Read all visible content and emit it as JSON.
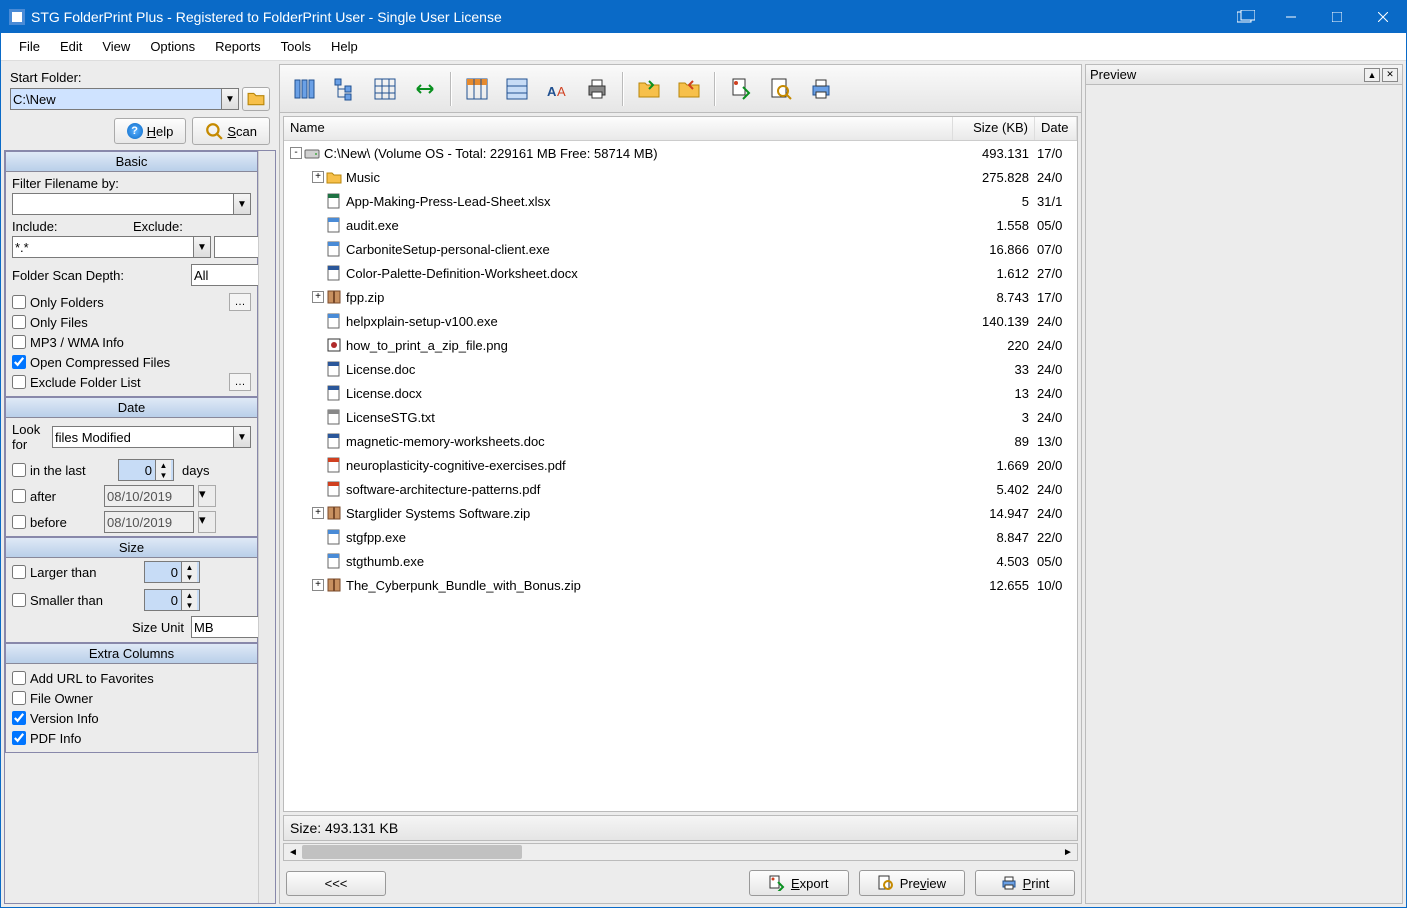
{
  "titlebar": "STG FolderPrint Plus - Registered to FolderPrint User - Single User License",
  "menu": [
    "File",
    "Edit",
    "View",
    "Options",
    "Reports",
    "Tools",
    "Help"
  ],
  "start": {
    "label": "Start Folder:",
    "value": "C:\\New",
    "help": "Help",
    "scan": "Scan"
  },
  "basic": {
    "title": "Basic",
    "filter_label": "Filter Filename by:",
    "filter_value": "",
    "include_label": "Include:",
    "include_value": "*.*",
    "exclude_label": "Exclude:",
    "exclude_value": "",
    "depth_label": "Folder Scan Depth:",
    "depth_value": "All",
    "only_folders": "Only Folders",
    "only_files": "Only Files",
    "mp3": "MP3 / WMA Info",
    "open_compressed": "Open Compressed Files",
    "exclude_list": "Exclude Folder List"
  },
  "date": {
    "title": "Date",
    "lookfor_label": "Look for",
    "lookfor_value": "files Modified",
    "inlast_label": "in the last",
    "inlast_value": "0",
    "days": "days",
    "after_label": "after",
    "after_value": "08/10/2019",
    "before_label": "before",
    "before_value": "08/10/2019"
  },
  "size": {
    "title": "Size",
    "larger": "Larger than",
    "larger_v": "0",
    "smaller": "Smaller than",
    "smaller_v": "0",
    "unit_label": "Size Unit",
    "unit_value": "MB"
  },
  "extra": {
    "title": "Extra Columns",
    "addurl": "Add URL to Favorites",
    "owner": "File Owner",
    "version": "Version Info",
    "pdf": "PDF Info"
  },
  "columns": {
    "name": "Name",
    "size": "Size (KB)",
    "date": "Date"
  },
  "rows": [
    {
      "depth": 0,
      "exp": "-",
      "icon": "drive",
      "name": "C:\\New\\ (Volume OS - Total: 229161 MB Free: 58714 MB)",
      "size": "493.131",
      "date": "17/0"
    },
    {
      "depth": 1,
      "exp": "+",
      "icon": "folder",
      "name": "Music",
      "size": "275.828",
      "date": "24/0"
    },
    {
      "depth": 1,
      "exp": "",
      "icon": "xls",
      "name": "App-Making-Press-Lead-Sheet.xlsx",
      "size": "5",
      "date": "31/1"
    },
    {
      "depth": 1,
      "exp": "",
      "icon": "exe",
      "name": "audit.exe",
      "size": "1.558",
      "date": "05/0"
    },
    {
      "depth": 1,
      "exp": "",
      "icon": "exe",
      "name": "CarboniteSetup-personal-client.exe",
      "size": "16.866",
      "date": "07/0"
    },
    {
      "depth": 1,
      "exp": "",
      "icon": "doc",
      "name": "Color-Palette-Definition-Worksheet.docx",
      "size": "1.612",
      "date": "27/0"
    },
    {
      "depth": 1,
      "exp": "+",
      "icon": "zip",
      "name": "fpp.zip",
      "size": "8.743",
      "date": "17/0"
    },
    {
      "depth": 1,
      "exp": "",
      "icon": "exe",
      "name": "helpxplain-setup-v100.exe",
      "size": "140.139",
      "date": "24/0"
    },
    {
      "depth": 1,
      "exp": "",
      "icon": "png",
      "name": "how_to_print_a_zip_file.png",
      "size": "220",
      "date": "24/0"
    },
    {
      "depth": 1,
      "exp": "",
      "icon": "doc",
      "name": "License.doc",
      "size": "33",
      "date": "24/0"
    },
    {
      "depth": 1,
      "exp": "",
      "icon": "doc",
      "name": "License.docx",
      "size": "13",
      "date": "24/0"
    },
    {
      "depth": 1,
      "exp": "",
      "icon": "txt",
      "name": "LicenseSTG.txt",
      "size": "3",
      "date": "24/0"
    },
    {
      "depth": 1,
      "exp": "",
      "icon": "doc",
      "name": "magnetic-memory-worksheets.doc",
      "size": "89",
      "date": "13/0"
    },
    {
      "depth": 1,
      "exp": "",
      "icon": "pdf",
      "name": "neuroplasticity-cognitive-exercises.pdf",
      "size": "1.669",
      "date": "20/0"
    },
    {
      "depth": 1,
      "exp": "",
      "icon": "pdf",
      "name": "software-architecture-patterns.pdf",
      "size": "5.402",
      "date": "24/0"
    },
    {
      "depth": 1,
      "exp": "+",
      "icon": "zip",
      "name": "Starglider Systems Software.zip",
      "size": "14.947",
      "date": "24/0"
    },
    {
      "depth": 1,
      "exp": "",
      "icon": "exe",
      "name": "stgfpp.exe",
      "size": "8.847",
      "date": "22/0"
    },
    {
      "depth": 1,
      "exp": "",
      "icon": "exe",
      "name": "stgthumb.exe",
      "size": "4.503",
      "date": "05/0"
    },
    {
      "depth": 1,
      "exp": "+",
      "icon": "zip",
      "name": "The_Cyberpunk_Bundle_with_Bonus.zip",
      "size": "12.655",
      "date": "10/0"
    }
  ],
  "status": "Size: 493.131 KB",
  "buttons": {
    "back": "<<<",
    "export": "Export",
    "preview": "Preview",
    "print": "Print"
  },
  "preview_title": "Preview"
}
